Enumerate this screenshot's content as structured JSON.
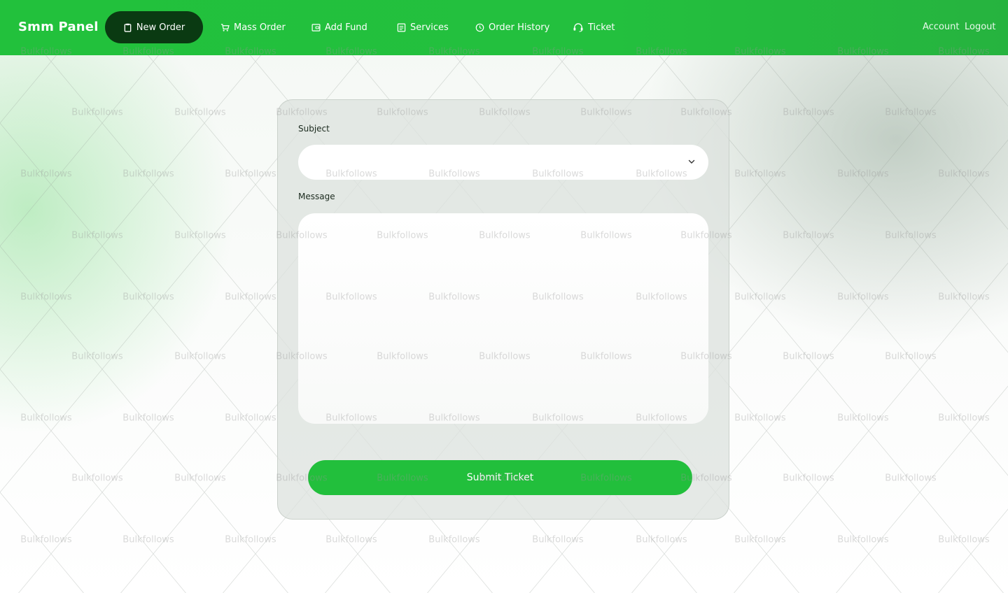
{
  "brand": "Smm Panel",
  "nav": {
    "new_order": "New Order",
    "mass_order": "Mass Order",
    "add_fund": "Add Fund",
    "services": "Services",
    "order_history": "Order History",
    "ticket": "Ticket",
    "account": "Account",
    "logout": "Logout"
  },
  "icons": {
    "new_order": "clipboard-icon",
    "mass_order": "cart-icon",
    "add_fund": "wallet-icon",
    "services": "document-icon",
    "order_history": "clock-icon",
    "ticket": "headset-icon",
    "select_toggle": "chevron-down-icon"
  },
  "form": {
    "subject_label": "Subject",
    "subject_value": "",
    "message_label": "Message",
    "message_value": "",
    "submit_label": "Submit Ticket"
  },
  "watermark": "Bulkfollows",
  "colors": {
    "primary_green": "#22c03d",
    "active_nav_bg": "#0a3a12",
    "card_bg": "#dfe4e0",
    "text_dark": "#1c2b1f"
  }
}
